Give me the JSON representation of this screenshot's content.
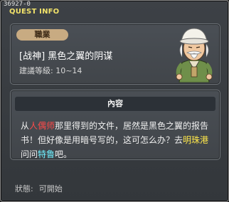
{
  "window": {
    "quest_id": "36927-0",
    "title": "QUEST INFO"
  },
  "quest": {
    "job_label": "職業",
    "name": "[战神] 黑色之翼的阴谋",
    "level_label": "建議等級",
    "level_range": "10~14"
  },
  "content": {
    "header": "內容",
    "segments": [
      {
        "text": "从",
        "style": "normal"
      },
      {
        "text": "人偶师",
        "style": "red"
      },
      {
        "text": "那里得到的文件，居然是黑色之翼的报告书！但好像是用暗号写的，这可怎么办？去",
        "style": "normal"
      },
      {
        "text": "明珠港",
        "style": "yellow"
      },
      {
        "text": "问问",
        "style": "normal"
      },
      {
        "text": "特鲁",
        "style": "cyan"
      },
      {
        "text": "吧。",
        "style": "normal"
      }
    ]
  },
  "status": {
    "label": "狀態:",
    "value": "可開始"
  },
  "colors": {
    "title": "#f2e36a",
    "badge_bg": "#c8ab82",
    "highlight_red": "#ff4a4a",
    "highlight_yellow": "#ffe84a",
    "highlight_cyan": "#6ef0ff"
  },
  "icons": {
    "npc": "npc-portrait-old-man-icon"
  }
}
